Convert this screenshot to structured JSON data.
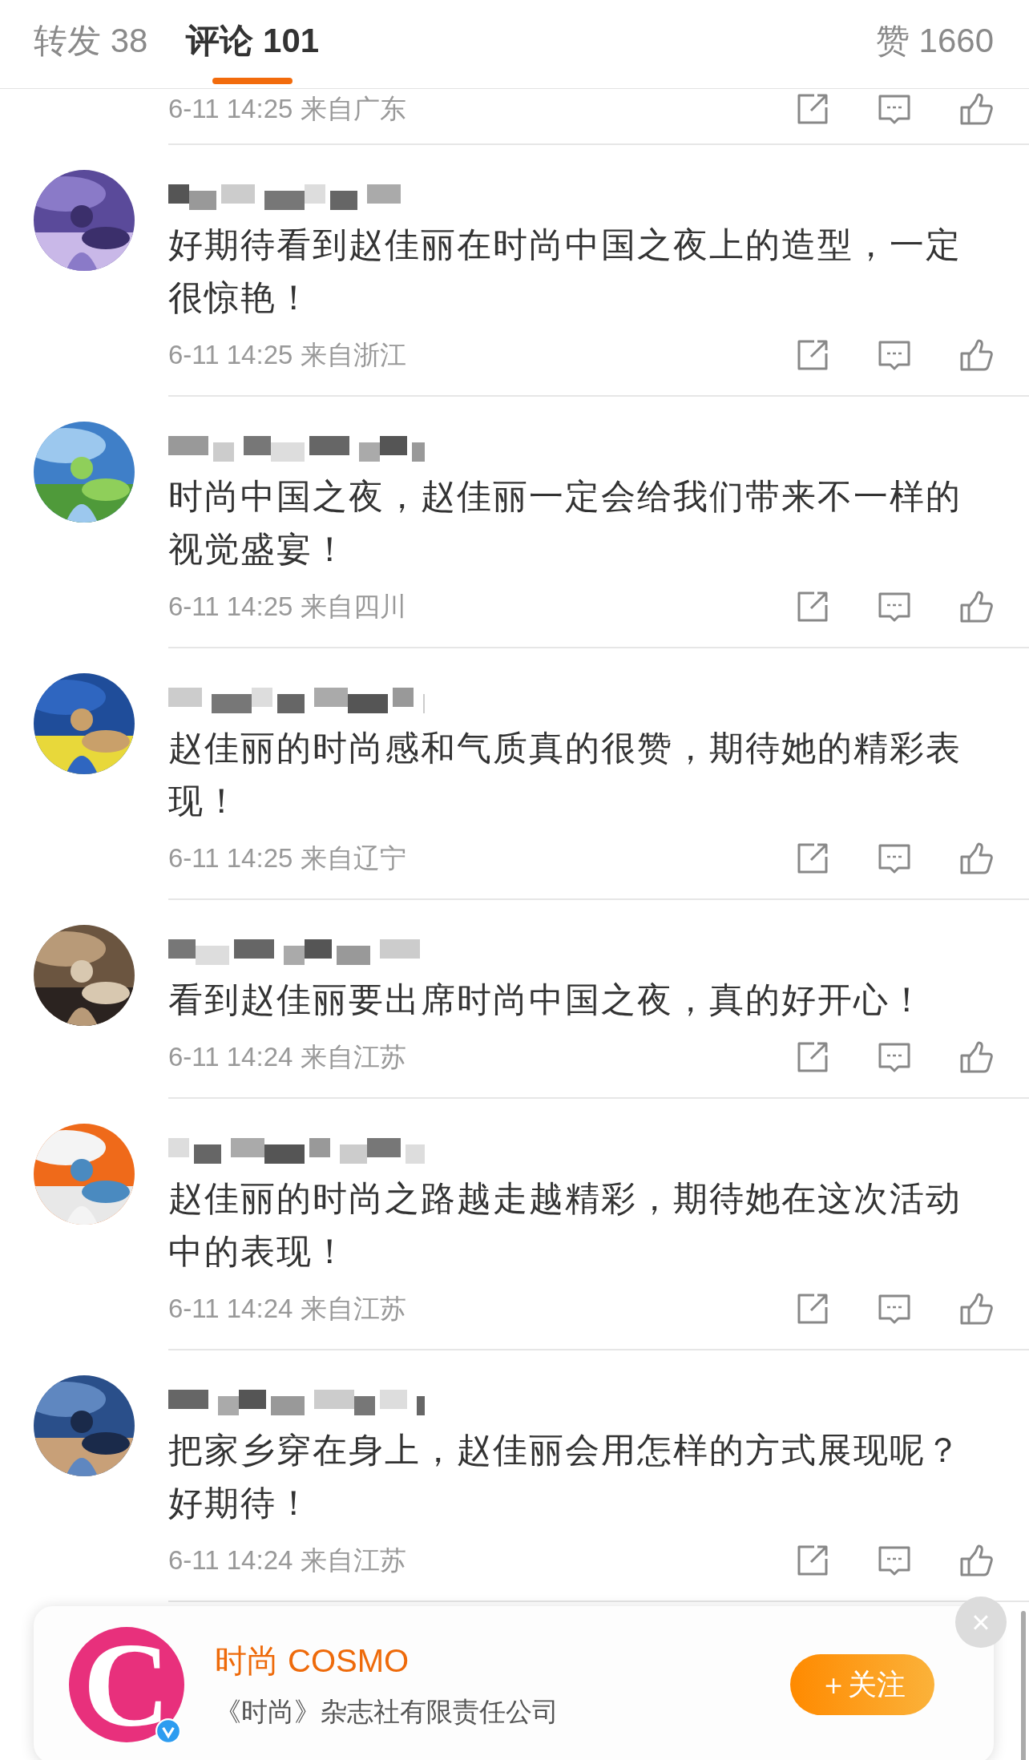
{
  "tabs": [
    {
      "label": "转发 38",
      "selected": false
    },
    {
      "label": "评论 101",
      "selected": true
    }
  ],
  "likes": "赞 1660",
  "top_row": {
    "time": "6-11 14:25 来自广东"
  },
  "comments": [
    {
      "text": "好期待看到赵佳丽在时尚中国之夜上的造型，一定很惊艳！",
      "time": "6-11 14:25 来自浙江"
    },
    {
      "text": "时尚中国之夜，赵佳丽一定会给我们带来不一样的视觉盛宴！",
      "time": "6-11 14:25 来自四川"
    },
    {
      "text": "赵佳丽的时尚感和气质真的很赞，期待她的精彩表现！",
      "time": "6-11 14:25 来自辽宁"
    },
    {
      "text": "看到赵佳丽要出席时尚中国之夜，真的好开心！",
      "time": "6-11 14:24 来自江苏"
    },
    {
      "text": "赵佳丽的时尚之路越走越精彩，期待她在这次活动中的表现！",
      "time": "6-11 14:24 来自江苏"
    },
    {
      "text": "把家乡穿在身上，赵佳丽会用怎样的方式展现呢？好期待！",
      "time": "6-11 14:24 来自江苏"
    }
  ],
  "popup": {
    "logo_letter": "C",
    "name": "时尚 COSMO",
    "description": "《时尚》杂志社有限责任公司",
    "follow_button": "＋关注",
    "close": "×"
  }
}
